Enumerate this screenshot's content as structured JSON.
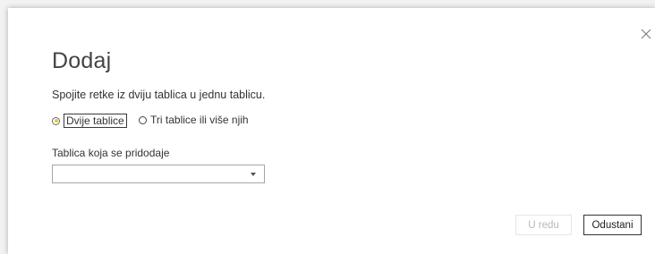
{
  "dialog": {
    "title": "Dodaj",
    "description": "Spojite retke iz dviju tablica u jednu tablicu.",
    "close_icon": "close-icon"
  },
  "options": [
    {
      "label": "Dvije tablice",
      "checked": true
    },
    {
      "label": "Tri tablice ili više njih",
      "checked": false
    }
  ],
  "table_field": {
    "label": "Tablica koja se pridodaje",
    "value": ""
  },
  "buttons": {
    "ok_label": "U redu",
    "ok_enabled": false,
    "cancel_label": "Odustani"
  },
  "colors": {
    "radio_accent": "#f2c811",
    "disabled_text": "#b8b8b8"
  }
}
